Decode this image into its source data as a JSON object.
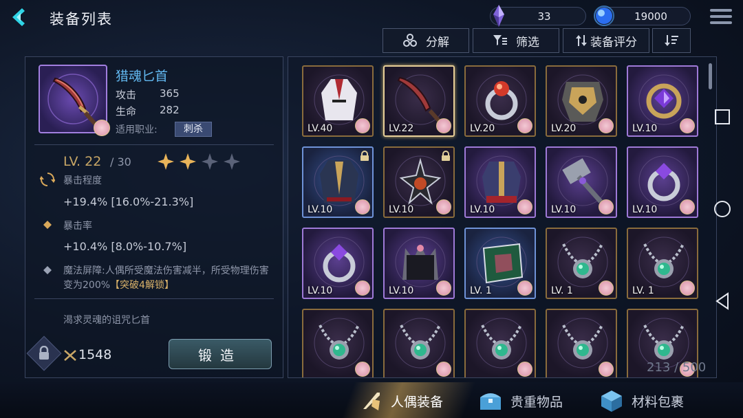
{
  "header": {
    "title": "装备列表"
  },
  "resources": [
    {
      "name": "crystal",
      "value": "33",
      "color": "#9a7cff"
    },
    {
      "name": "blue-orb",
      "value": "19000",
      "color": "#3e86ff"
    }
  ],
  "toolbar": {
    "decompose": "分解",
    "filter": "筛选",
    "sort_score": "装备评分"
  },
  "detail": {
    "name": "猎魂匕首",
    "attack_label": "攻击",
    "attack_value": "365",
    "hp_label": "生命",
    "hp_value": "282",
    "job_label": "适用职业:",
    "job_value": "刺杀",
    "level": "LV. 22",
    "level_max": "/ 30",
    "stars_filled": 2,
    "stars_total": 4,
    "sub1_name": "暴击程度",
    "sub1_value": "+19.4% [16.0%-21.3%]",
    "sub2_name": "暴击率",
    "sub2_value": "+10.4% [8.0%-10.7%]",
    "passive_text": "魔法屏障:人偶所受魔法伤害减半，所受物理伤害变为200%",
    "passive_unlock": "【突破4解锁】",
    "description": "渴求灵魂的诅咒匕首",
    "power": "1548",
    "forge_label": "锻造"
  },
  "inventory": {
    "count": "213 / 500",
    "items": [
      {
        "lv": "LV.40",
        "frame": "gold",
        "icon": "coat"
      },
      {
        "lv": "LV.22",
        "frame": "gold-selected",
        "icon": "dagger"
      },
      {
        "lv": "LV.20",
        "frame": "gold",
        "icon": "ring-red"
      },
      {
        "lv": "LV.20",
        "frame": "gold",
        "icon": "armor"
      },
      {
        "lv": "LV.10",
        "frame": "purple",
        "icon": "amulet-purple"
      },
      {
        "lv": "LV.10",
        "frame": "blue",
        "icon": "uniform",
        "locked": true
      },
      {
        "lv": "LV.10",
        "frame": "gold",
        "icon": "pendant-star",
        "locked": true
      },
      {
        "lv": "LV.10",
        "frame": "purple",
        "icon": "jacket"
      },
      {
        "lv": "LV.10",
        "frame": "purple",
        "icon": "hammer"
      },
      {
        "lv": "LV.10",
        "frame": "purple",
        "icon": "ring-purple"
      },
      {
        "lv": "LV.10",
        "frame": "purple",
        "icon": "ring-purple"
      },
      {
        "lv": "LV.10",
        "frame": "purple",
        "icon": "crown"
      },
      {
        "lv": "LV. 1",
        "frame": "blue",
        "icon": "book"
      },
      {
        "lv": "LV. 1",
        "frame": "gold",
        "icon": "necklace-green"
      },
      {
        "lv": "LV. 1",
        "frame": "gold",
        "icon": "necklace-green"
      },
      {
        "lv": "",
        "frame": "gold",
        "icon": "necklace-green"
      },
      {
        "lv": "",
        "frame": "gold",
        "icon": "necklace-green"
      },
      {
        "lv": "",
        "frame": "gold",
        "icon": "necklace-green"
      },
      {
        "lv": "",
        "frame": "gold",
        "icon": "necklace-green"
      },
      {
        "lv": "",
        "frame": "gold",
        "icon": "necklace-green"
      }
    ]
  },
  "bottom_tabs": [
    {
      "label": "人偶装备",
      "icon": "sword-shield-icon",
      "active": true
    },
    {
      "label": "贵重物品",
      "icon": "treasure-chest-icon",
      "active": false
    },
    {
      "label": "材料包裹",
      "icon": "cube-icon",
      "active": false
    }
  ]
}
